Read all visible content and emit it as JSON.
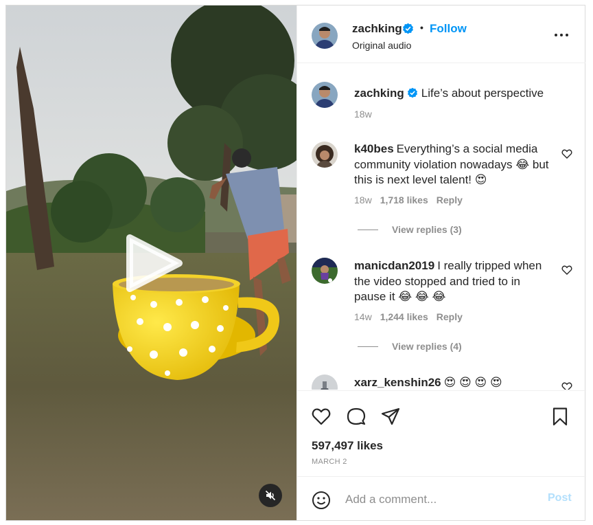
{
  "post": {
    "author": "zachking",
    "follow_label": "Follow",
    "separator": "•",
    "audio": "Original audio",
    "more_icon": "more-horizontal-icon"
  },
  "caption": {
    "user": "zachking",
    "text": "Life’s about perspective",
    "time": "18w"
  },
  "comments": [
    {
      "user": "k40bes",
      "text": "Everything’s a social media community violation nowadays 😂 but this is next level talent! 😍",
      "time": "18w",
      "likes": "1,718 likes",
      "reply": "Reply",
      "view_replies": "View replies (3)"
    },
    {
      "user": "manicdan2019",
      "text": "I really tripped when the video stopped and tried to in pause it 😂 😂 😂",
      "time": "14w",
      "likes": "1,244 likes",
      "reply": "Reply",
      "view_replies": "View replies (4)"
    },
    {
      "user": "xarz_kenshin26",
      "text": "😍 😍 😍 😍"
    }
  ],
  "actions": {
    "likes": "597,497 likes",
    "date": "MARCH 2"
  },
  "comment_box": {
    "placeholder": "Add a comment...",
    "post_label": "Post"
  },
  "colors": {
    "accent": "#0095f6",
    "verified": "#0095f6",
    "muted": "#8e8e8e",
    "post_disabled": "#b2dffc"
  }
}
